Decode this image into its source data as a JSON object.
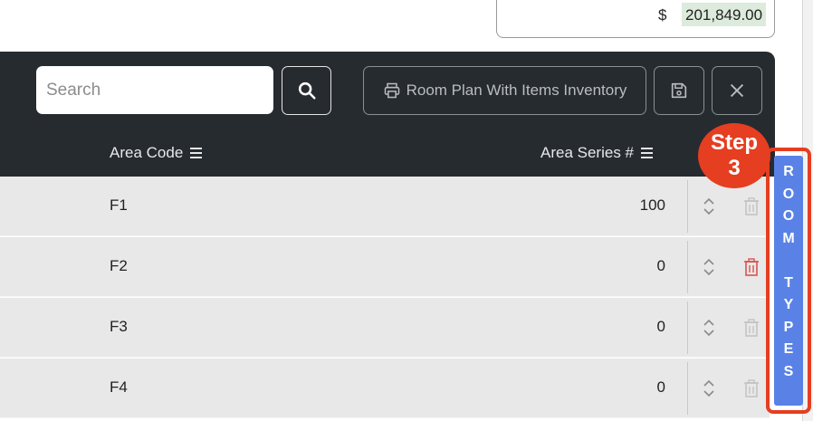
{
  "total": {
    "currency": "$",
    "amount": "201,849.00"
  },
  "toolbar": {
    "search_placeholder": "Search",
    "room_plan_label": "Room Plan With Items Inventory"
  },
  "columns": {
    "area_code": "Area Code",
    "area_series": "Area Series #"
  },
  "rows": [
    {
      "code": "F1",
      "series": "100",
      "delete_enabled": false
    },
    {
      "code": "F2",
      "series": "0",
      "delete_enabled": true
    },
    {
      "code": "F3",
      "series": "0",
      "delete_enabled": false
    },
    {
      "code": "F4",
      "series": "0",
      "delete_enabled": false
    }
  ],
  "step_badge": {
    "line1": "Step",
    "line2": "3"
  },
  "room_types_tab": {
    "letters": [
      "R",
      "O",
      "O",
      "M",
      " ",
      "T",
      "Y",
      "P",
      "E",
      "S"
    ]
  },
  "icons": {
    "search": "search-icon",
    "print": "printer-icon",
    "save": "save-icon",
    "close": "close-icon",
    "column_menu": "menu-icon",
    "drag": "drag-handle-icon",
    "delete": "trash-icon"
  },
  "colors": {
    "header_bg": "#262b30",
    "row_bg": "#e8e8e8",
    "badge_red": "#e53e21",
    "tab_blue": "#5a82e6",
    "amount_highlight": "#dcebdc",
    "trash_active": "#d9534f",
    "trash_disabled": "#c4c4c4"
  }
}
